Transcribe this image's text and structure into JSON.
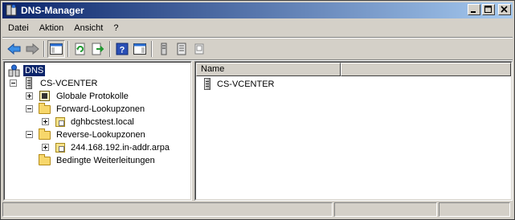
{
  "window": {
    "title": "DNS-Manager",
    "icon": "dns-manager-icon"
  },
  "menu": {
    "items": [
      {
        "label": "Datei"
      },
      {
        "label": "Aktion"
      },
      {
        "label": "Ansicht"
      },
      {
        "label": "?"
      }
    ]
  },
  "toolbar": {
    "buttons": [
      {
        "icon": "back-arrow-icon"
      },
      {
        "icon": "forward-arrow-icon"
      },
      {
        "icon": "show-hide-console-tree-icon"
      },
      {
        "icon": "refresh-icon"
      },
      {
        "icon": "export-list-icon"
      },
      {
        "icon": "help-icon"
      },
      {
        "icon": "show-hide-action-pane-icon"
      },
      {
        "icon": "server-icon"
      },
      {
        "icon": "properties-icon"
      },
      {
        "icon": "zone-icon"
      }
    ]
  },
  "tree": {
    "root": "DNS",
    "server": "CS-VCENTER",
    "global_logs": "Globale Protokolle",
    "forward_zones": "Forward-Lookupzonen",
    "forward_child": "dghbcstest.local",
    "reverse_zones": "Reverse-Lookupzonen",
    "reverse_child": "244.168.192.in-addr.arpa",
    "conditional_forwarders": "Bedingte Weiterleitungen"
  },
  "list": {
    "columns": [
      "Name",
      ""
    ],
    "rows": [
      {
        "name": "CS-VCENTER",
        "icon": "server-icon"
      }
    ]
  },
  "colors": {
    "title_start": "#0a246a",
    "title_end": "#a6caf0",
    "selection": "#0a246a",
    "face": "#d4d0c8"
  }
}
